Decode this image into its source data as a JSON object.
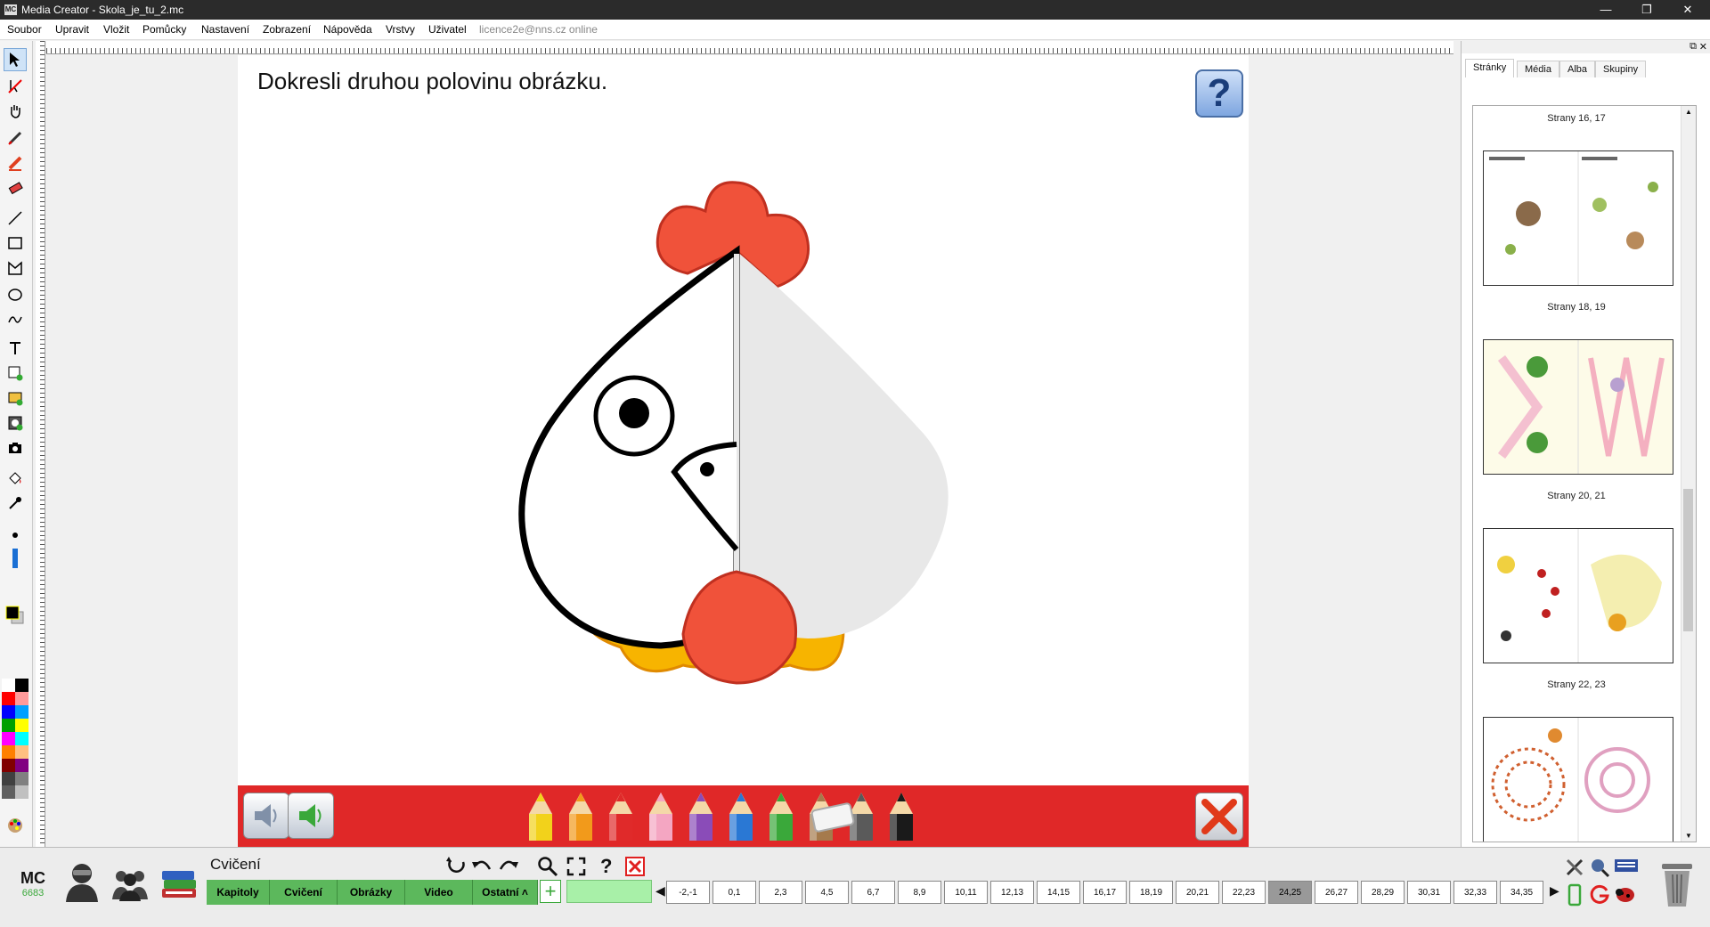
{
  "window": {
    "title": "Media Creator - Skola_je_tu_2.mc",
    "app_badge": "MC",
    "minimize": "—",
    "maximize": "❐",
    "close": "✕"
  },
  "menu": [
    "Soubor",
    "Upravit",
    "Vložit",
    "Pomůcky",
    "Nastavení",
    "Zobrazení",
    "Nápověda",
    "Vrstvy",
    "Uživatel"
  ],
  "status": "licence2e@nns.cz online",
  "page": {
    "instruction": "Dokresli druhou polovinu obrázku.",
    "help_symbol": "?"
  },
  "pencil_colors": [
    "#f2d21b",
    "#f29a1b",
    "#e02a2a",
    "#f4a6c2",
    "#8a4cb8",
    "#2a78d4",
    "#3aa83a",
    "#a57a4c",
    "#5a5a5a",
    "#1a1a1a"
  ],
  "palette_colors": [
    "#ffffff",
    "#000000",
    "#ff0000",
    "#ff9a9a",
    "#0000ff",
    "#00a0ff",
    "#00a000",
    "#ffff00",
    "#ff00ff",
    "#00ffff",
    "#ff8000",
    "#ffc080",
    "#800000",
    "#800080",
    "#404040",
    "#808080",
    "#606060",
    "#c0c0c0"
  ],
  "side_panel": {
    "tabs": [
      "Stránky",
      "Média",
      "Alba",
      "Skupiny"
    ],
    "active_tab": "Stránky",
    "pages": [
      "Strany 16, 17",
      "Strany 18, 19",
      "Strany 20, 21",
      "Strany 22, 23"
    ]
  },
  "bottom": {
    "mc_label": "MC",
    "mc_number": "6683",
    "section": "Cvičení",
    "nav_tabs": [
      "Kapitoly",
      "Cvičení",
      "Obrázky",
      "Video",
      "Ostatní ˄"
    ],
    "page_buttons": [
      "-2,-1",
      "0,1",
      "2,3",
      "4,5",
      "6,7",
      "8,9",
      "10,11",
      "12,13",
      "14,15",
      "16,17",
      "18,19",
      "20,21",
      "22,23",
      "24,25",
      "26,27",
      "28,29",
      "30,31",
      "32,33",
      "34,35"
    ],
    "active_page": "24,25"
  }
}
